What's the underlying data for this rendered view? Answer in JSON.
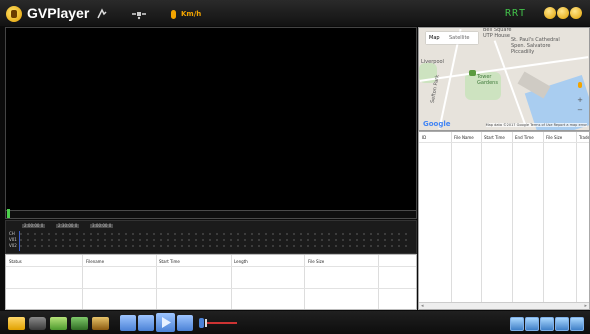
{
  "app": {
    "title": "GVPlayer",
    "speed_text": "Km/h",
    "status_label": "RRT"
  },
  "icons": {
    "logo": "player-logo-icon",
    "signal": "signal-icon",
    "satellite": "satellite-icon",
    "window_buttons": [
      "minimize-icon",
      "maximize-icon",
      "close-icon"
    ]
  },
  "colors": {
    "accent": "#f2a400",
    "status_green": "#42c24a",
    "seek_green": "#4cd04c",
    "play_blue": "#4b82d6"
  },
  "timeline": {
    "ticks": [
      "2:00:00 0",
      "2:30:00 0",
      "3:00:00 0"
    ],
    "rows": [
      "CH",
      "V01",
      "V02"
    ]
  },
  "file_table": {
    "columns": [
      "Status",
      "Filename",
      "Start Time",
      "Length",
      "File Size"
    ]
  },
  "map": {
    "tabs": [
      "Map",
      "Satellite"
    ],
    "labels": [
      "Bell Square\nUTP House",
      "St. Paul's Cathedral\nSpen. Salvatore\nPiccadilly",
      "Liverpool",
      "Tower\nGardens",
      "Sefton Park"
    ],
    "google": "Google",
    "attribution": "Map data ©2017 Google   Terms of Use   Report a map error",
    "zoom_in": "+",
    "zoom_out": "−"
  },
  "right_table": {
    "columns": [
      "ID",
      "File Name",
      "Start Time",
      "End Time",
      "File Size",
      "Trade"
    ],
    "scroll_left": "◂",
    "scroll_right": "▸"
  },
  "bottom_bar": {
    "left_icons": [
      "open-folder-icon",
      "camera-icon",
      "export-icon",
      "film-icon",
      "settings-box-icon"
    ],
    "playback": [
      "rewind-icon",
      "stop-icon",
      "play-icon",
      "fast-forward-icon"
    ],
    "right_icons": [
      "layout-icon",
      "grid-icon",
      "person-icon",
      "map-view-icon",
      "fullscreen-icon"
    ]
  }
}
